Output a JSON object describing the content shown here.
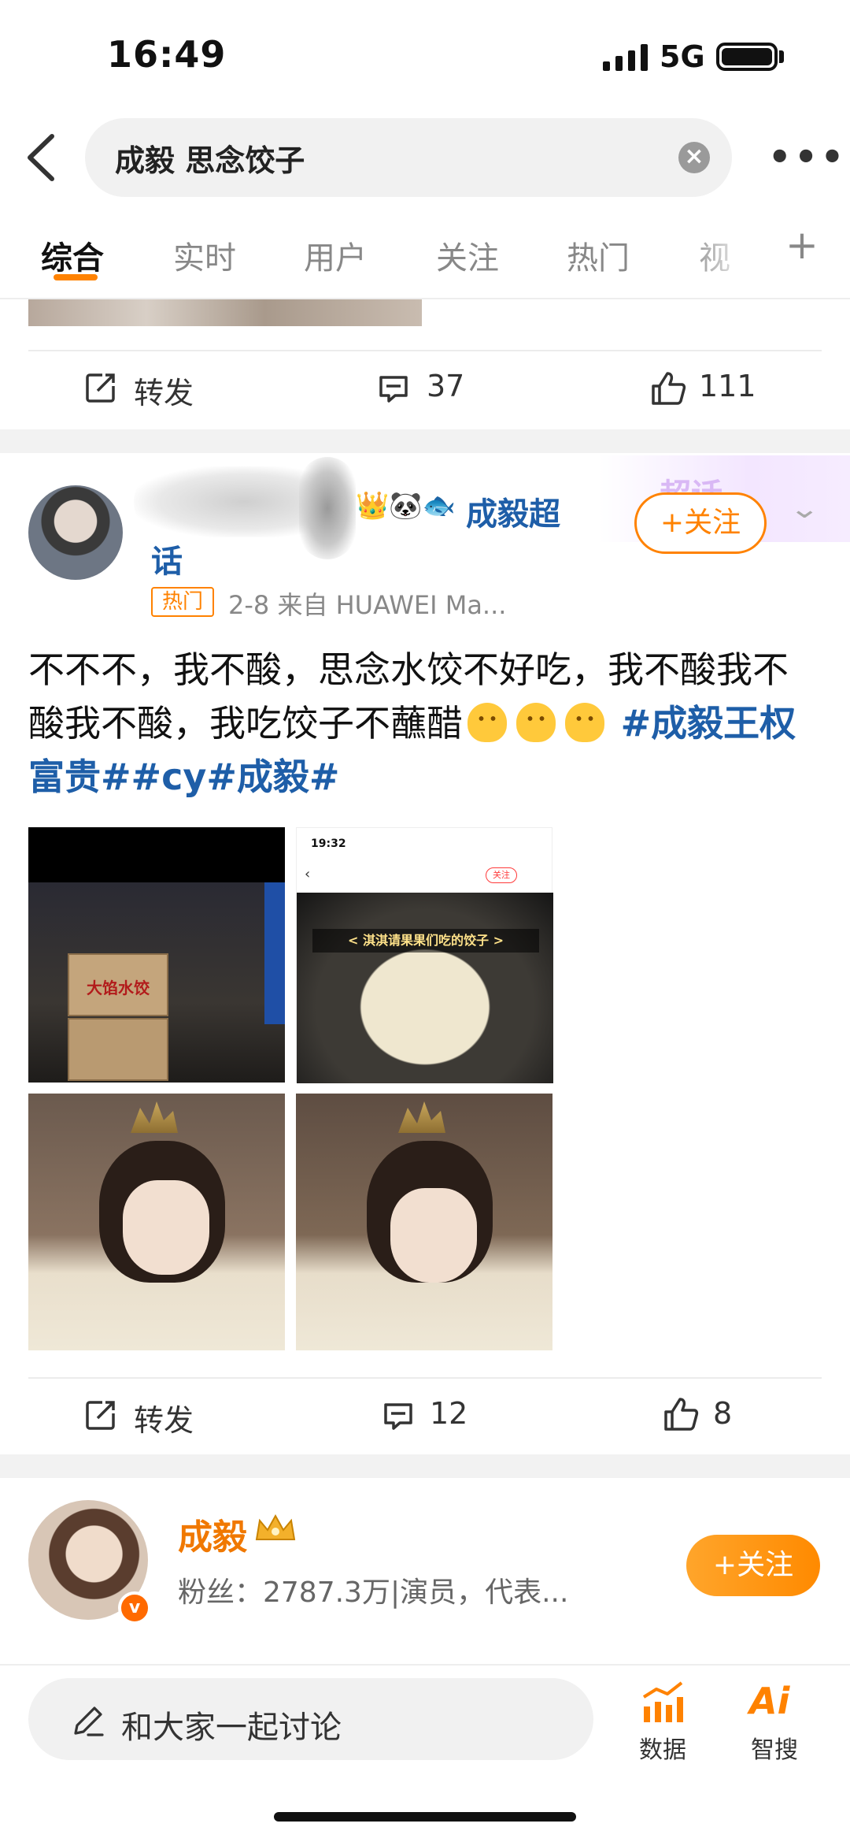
{
  "status": {
    "time": "16:49",
    "network": "5G"
  },
  "search": {
    "query": "成毅 思念饺子",
    "clear_icon": "close-circle-icon",
    "more_icon": "more-dots-icon"
  },
  "tabs": [
    {
      "label": "综合",
      "active": true
    },
    {
      "label": "实时"
    },
    {
      "label": "用户"
    },
    {
      "label": "关注"
    },
    {
      "label": "热门"
    },
    {
      "label": "视"
    }
  ],
  "tab_plus": "+",
  "prev_post_actions": {
    "repost": "转发",
    "comments": "37",
    "likes": "111"
  },
  "post": {
    "username": "成毅超",
    "username_tail": "话",
    "super_label": "超话",
    "follow_label": "+关注",
    "hot_tag": "热门",
    "meta": "2-8  来自 HUAWEI Ma...",
    "text_plain": "不不不，我不酸，思念水饺不好吃，我不酸我不酸我不酸，我吃饺子不蘸醋",
    "hashtag_1": "#成毅",
    "hashtag_1b": "王权富贵#",
    "hashtag_2": "cy#",
    "hashtag_3": "成毅#",
    "img_a_box_label": "大馅水饺",
    "img_b_time": "19:32",
    "img_b_follow": "关注",
    "img_b_caption": "< 淇淇请果果们吃的饺子 >",
    "actions": {
      "repost": "转发",
      "comments": "12",
      "likes": "8"
    }
  },
  "user_card": {
    "name": "成毅",
    "fans": "粉丝：2787.3万|演员，代表...",
    "follow_label": "+关注"
  },
  "bottom": {
    "discuss_placeholder": "和大家一起讨论",
    "data_label": "数据",
    "ai_label": "智搜",
    "ai_glyph": "Ai"
  },
  "colors": {
    "accent": "#ff8200",
    "link": "#1e5ea8"
  }
}
